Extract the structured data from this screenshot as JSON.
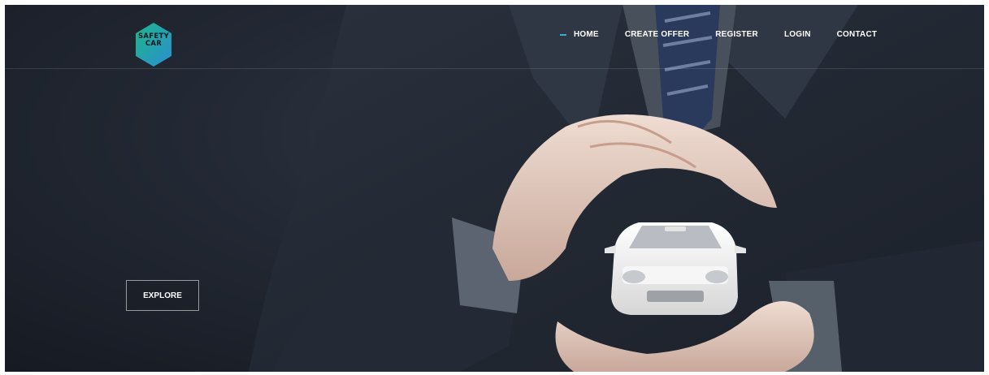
{
  "header": {
    "logo_text": "SAFETY\nCAR",
    "nav": [
      {
        "label": "HOME",
        "active": true
      },
      {
        "label": "CREATE OFFER"
      },
      {
        "label": "REGISTER"
      },
      {
        "label": "LOGIN"
      },
      {
        "label": "CONTACT"
      }
    ]
  },
  "hero": {
    "cta_label": "EXPLORE",
    "image": "businessman-hands-protecting-car"
  },
  "colors": {
    "accent": "#2fb3c6",
    "logo_green": "#1fb58a",
    "logo_blue": "#2a8fd0",
    "background": "#1d222c"
  }
}
